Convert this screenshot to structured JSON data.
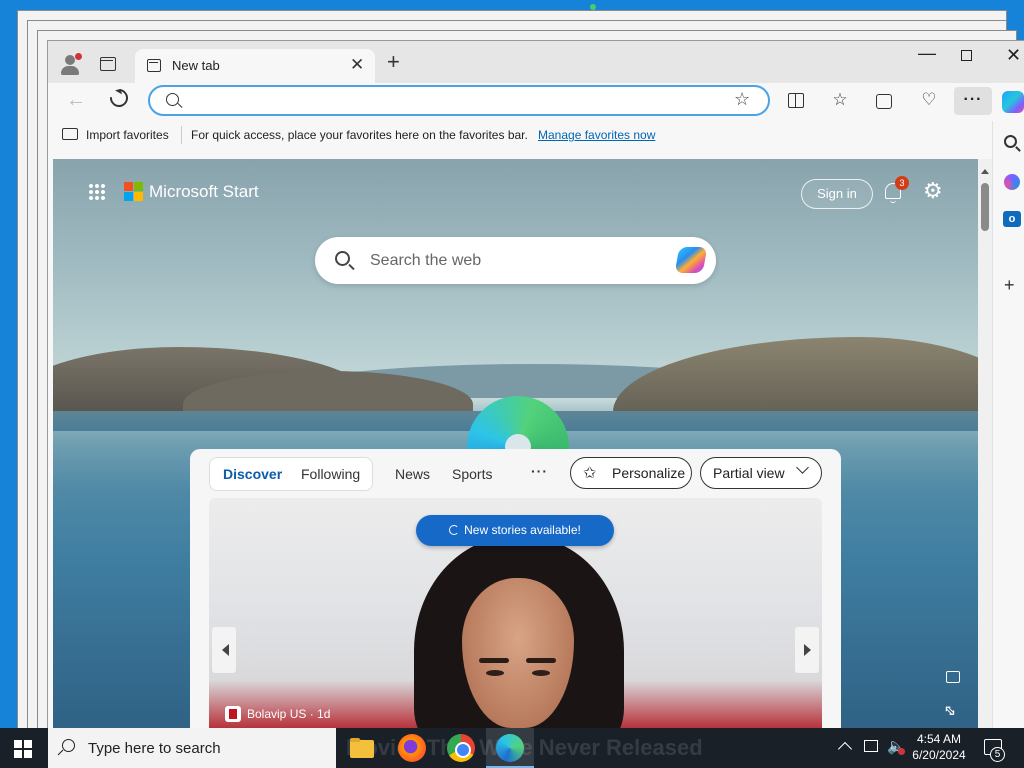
{
  "browser": {
    "tab_title": "New tab",
    "address_value": "",
    "favorites_bar": {
      "import_label": "Import favorites",
      "hint": "For quick access, place your favorites here on the favorites bar.",
      "manage_link": "Manage favorites now"
    },
    "toolbar_icons": [
      "split-screen-icon",
      "favorites-icon",
      "collections-icon",
      "browser-essentials-icon",
      "more-icon",
      "copilot-icon"
    ]
  },
  "page": {
    "brand": "Microsoft Start",
    "sign_in": "Sign in",
    "notification_count": "3",
    "search_placeholder": "Search the web",
    "feed": {
      "tabs": [
        "Discover",
        "Following"
      ],
      "active_tab": "Discover",
      "nav_links": [
        "News",
        "Sports"
      ],
      "more": "···",
      "personalize": "Personalize",
      "view_select": "Partial view",
      "new_stories": "New stories available!",
      "story_source": "Bolavip US · 1d"
    }
  },
  "taskbar": {
    "search_placeholder": "Type here to search",
    "background_text": "Movies That Were Never Released",
    "time": "4:54 AM",
    "date": "6/20/2024",
    "notification_count": "5",
    "apps": [
      "file-explorer",
      "firefox",
      "chrome",
      "edge"
    ]
  },
  "colors": {
    "desktop": "#1683d8",
    "accent": "#1769c8",
    "taskbar": "#1a2028",
    "link": "#0066b4"
  }
}
